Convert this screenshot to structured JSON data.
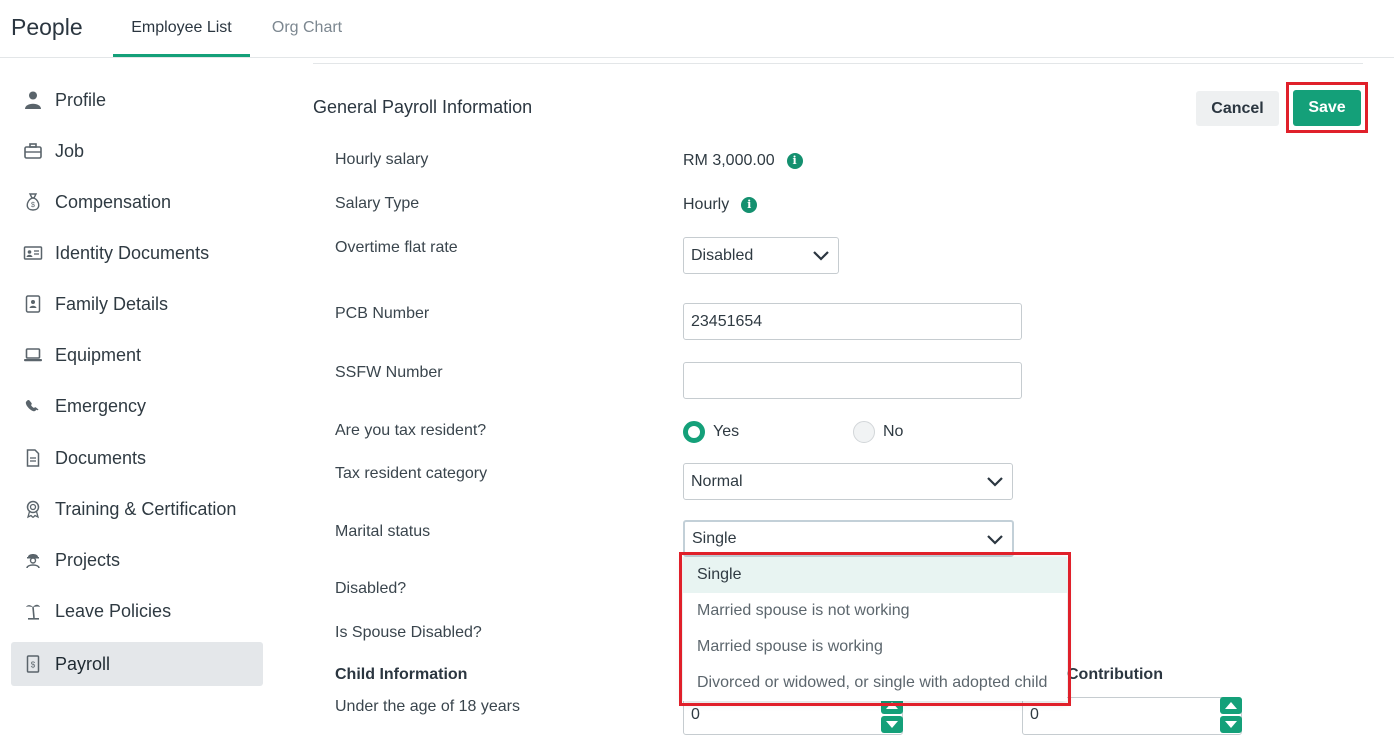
{
  "header": {
    "app_title": "People",
    "tabs": [
      {
        "label": "Employee List",
        "active": true
      },
      {
        "label": "Org Chart",
        "active": false
      }
    ]
  },
  "sidebar": {
    "items": [
      {
        "label": "Profile",
        "icon": "person-icon"
      },
      {
        "label": "Job",
        "icon": "briefcase-icon"
      },
      {
        "label": "Compensation",
        "icon": "money-bag-icon"
      },
      {
        "label": "Identity Documents",
        "icon": "id-card-icon"
      },
      {
        "label": "Family Details",
        "icon": "contact-book-icon"
      },
      {
        "label": "Equipment",
        "icon": "laptop-icon"
      },
      {
        "label": "Emergency",
        "icon": "phone-icon"
      },
      {
        "label": "Documents",
        "icon": "document-icon"
      },
      {
        "label": "Training & Certification",
        "icon": "award-icon"
      },
      {
        "label": "Projects",
        "icon": "worker-icon"
      },
      {
        "label": "Leave Policies",
        "icon": "palm-tree-icon"
      },
      {
        "label": "Payroll",
        "icon": "payroll-icon",
        "active": true
      }
    ]
  },
  "main": {
    "section_title": "General Payroll Information",
    "cancel_label": "Cancel",
    "save_label": "Save",
    "fields": {
      "hourly_salary": {
        "label": "Hourly salary",
        "value": "RM 3,000.00"
      },
      "salary_type": {
        "label": "Salary Type",
        "value": "Hourly"
      },
      "overtime": {
        "label": "Overtime flat rate",
        "value": "Disabled"
      },
      "pcb": {
        "label": "PCB Number",
        "value": "23451654"
      },
      "ssfw": {
        "label": "SSFW Number",
        "value": ""
      },
      "tax_resident": {
        "label": "Are you tax resident?",
        "yes": "Yes",
        "no": "No",
        "selected": "Yes"
      },
      "tax_category": {
        "label": "Tax resident category",
        "value": "Normal"
      },
      "marital": {
        "label": "Marital status",
        "value": "Single"
      },
      "disabled": {
        "label": "Disabled?"
      },
      "spouse_disabled": {
        "label": "Is Spouse Disabled?"
      }
    },
    "marital_options": [
      "Single",
      "Married spouse is not working",
      "Married spouse is working",
      "Divorced or widowed, or single with adopted child"
    ],
    "child_info": {
      "heading": "Child Information",
      "under18_label": "Under the age of 18 years",
      "under18_value": "0",
      "contribution_heading": "Contribution",
      "contribution_value": "0"
    }
  },
  "colors": {
    "accent": "#14a079",
    "highlight": "#e0202a"
  }
}
